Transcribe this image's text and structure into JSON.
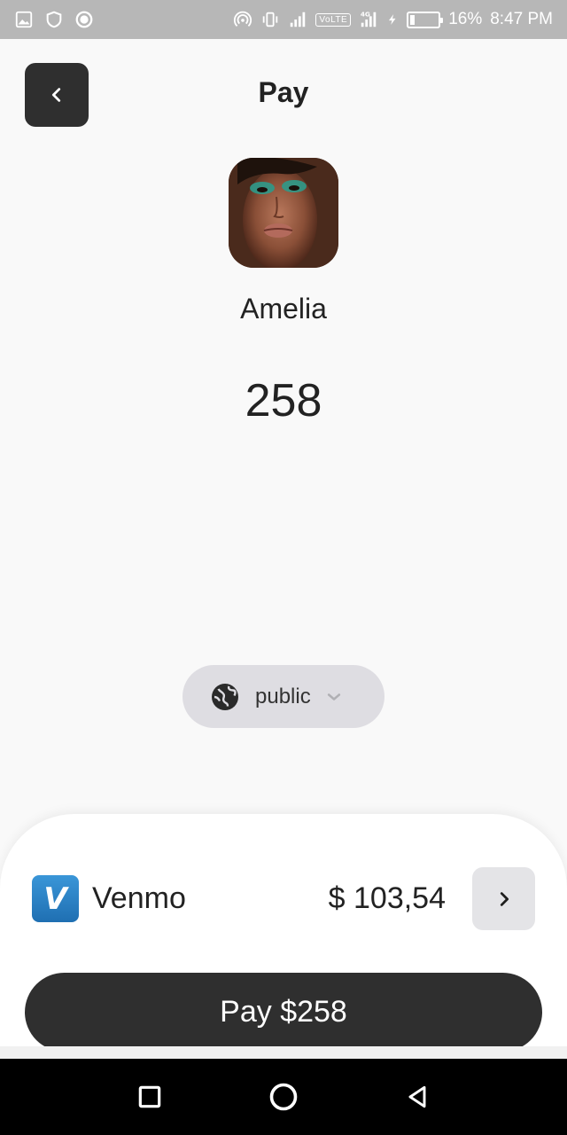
{
  "status_bar": {
    "battery_percent": "16%",
    "time": "8:47 PM",
    "volte_label": "VoLTE",
    "network_label": "4G",
    "battery_level": 0.16,
    "icons": [
      "image-icon",
      "shield-icon",
      "record-icon",
      "hotspot-icon",
      "vibrate-icon",
      "signal-icon",
      "volte-icon",
      "signal-4g-icon",
      "charging-icon",
      "battery-icon"
    ]
  },
  "header": {
    "title": "Pay",
    "back_icon": "chevron-left-icon"
  },
  "recipient": {
    "name": "Amelia",
    "avatar": "avatar-photo"
  },
  "payment": {
    "amount": "258"
  },
  "privacy": {
    "label": "public",
    "icon": "globe-icon",
    "dropdown_icon": "chevron-down-icon"
  },
  "payment_method": {
    "logo_letter": "V",
    "name": "Venmo",
    "balance": "$ 103,54",
    "next_icon": "chevron-right-icon",
    "brand_color": "#1f7ac2"
  },
  "pay_button": {
    "label": "Pay $258"
  },
  "nav_bar": {
    "icons": [
      "recents-icon",
      "home-icon",
      "back-icon"
    ]
  },
  "colors": {
    "status_bar": "#b7b7b7",
    "dark_button": "#2f2f2f",
    "pill": "#dedde2",
    "background": "#f9f9f9"
  }
}
